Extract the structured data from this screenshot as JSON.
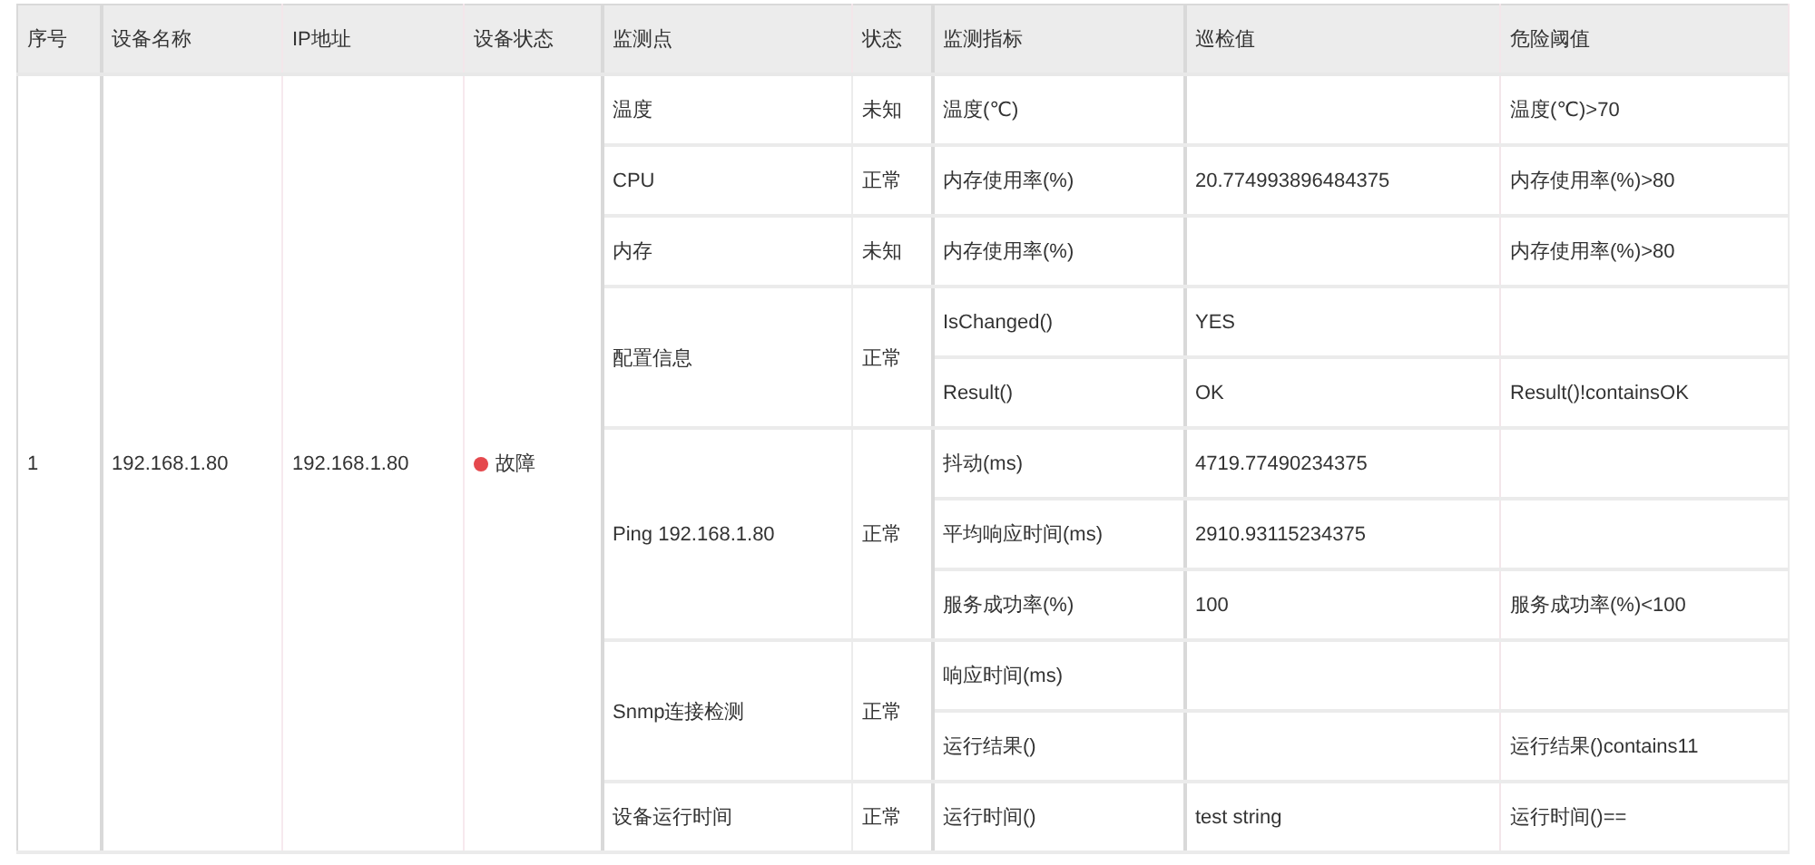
{
  "table": {
    "columns": [
      "序号",
      "设备名称",
      "IP地址",
      "设备状态",
      "监测点",
      "状态",
      "监测指标",
      "巡检值",
      "危险阈值"
    ],
    "devices": [
      {
        "index": "1",
        "name": "192.168.1.80",
        "ip": "192.168.1.80",
        "status": {
          "label": "故障",
          "color": "#e5484d"
        },
        "points": [
          {
            "name": "温度",
            "state": "未知",
            "metrics": [
              {
                "indicator": "温度(℃)",
                "threshold": "温度(℃)>70"
              }
            ]
          },
          {
            "name": "CPU",
            "state": "正常",
            "metrics": [
              {
                "indicator": "内存使用率(%)",
                "value": "20.774993896484375",
                "threshold": "内存使用率(%)>80"
              }
            ]
          },
          {
            "name": "内存",
            "state": "未知",
            "metrics": [
              {
                "indicator": "内存使用率(%)",
                "threshold": "内存使用率(%)>80"
              }
            ]
          },
          {
            "name": "配置信息",
            "state": "正常",
            "metrics": [
              {
                "indicator": "IsChanged()",
                "value": "YES"
              },
              {
                "indicator": "Result()",
                "value": "OK",
                "threshold": "Result()!containsOK"
              }
            ]
          },
          {
            "name": "Ping 192.168.1.80",
            "state": "正常",
            "metrics": [
              {
                "indicator": "抖动(ms)",
                "value": "4719.77490234375"
              },
              {
                "indicator": "平均响应时间(ms)",
                "value": "2910.93115234375"
              },
              {
                "indicator": "服务成功率(%)",
                "value": "100",
                "threshold": "服务成功率(%)<100"
              }
            ]
          },
          {
            "name": "Snmp连接检测",
            "state": "正常",
            "metrics": [
              {
                "indicator": "响应时间(ms)"
              },
              {
                "indicator": "运行结果()",
                "threshold": "运行结果()contains11"
              }
            ]
          },
          {
            "name": "设备运行时间",
            "state": "正常",
            "metrics": [
              {
                "indicator": "运行时间()",
                "value": "test string",
                "threshold": "运行时间()=="
              }
            ]
          }
        ]
      }
    ]
  }
}
